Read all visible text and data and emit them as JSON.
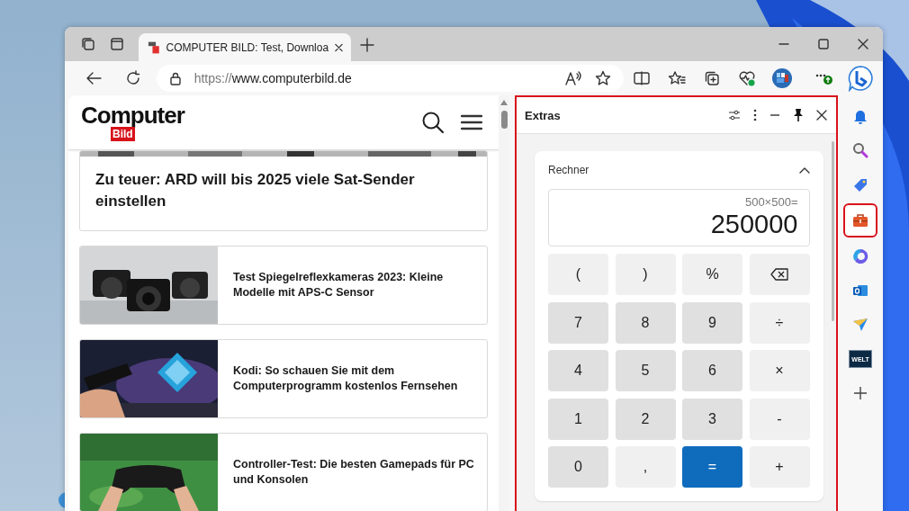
{
  "browser": {
    "tabs": [
      {
        "title": "COMPUTER BILD: Test, Downloa",
        "selected": true
      }
    ],
    "address": {
      "scheme": "https://",
      "host": "www.computerbild.de"
    }
  },
  "web_page": {
    "logo": {
      "word": "Computer",
      "sub": "Bild"
    },
    "articles": [
      {
        "kind": "wide",
        "title": "Zu teuer: ARD will bis 2025 viele Sat-Sender einstellen"
      },
      {
        "kind": "thumb",
        "title": "Test Spiegelreflexkameras 2023: Kleine Modelle mit APS-C Sensor"
      },
      {
        "kind": "thumb",
        "title": "Kodi: So schauen Sie mit dem Computerprogramm kostenlos Fernsehen"
      },
      {
        "kind": "thumb",
        "title": "Controller-Test: Die besten Gamepads für PC und Konsolen"
      }
    ]
  },
  "extras_pane": {
    "title": "Extras",
    "highlighted": true,
    "calculator": {
      "title": "Rechner",
      "expanded": true,
      "expression": "500×500=",
      "result": "250000",
      "keys": [
        {
          "label": "(",
          "kind": "op"
        },
        {
          "label": ")",
          "kind": "op"
        },
        {
          "label": "%",
          "kind": "op"
        },
        {
          "kind": "backspace"
        },
        {
          "label": "7",
          "kind": "digit"
        },
        {
          "label": "8",
          "kind": "digit"
        },
        {
          "label": "9",
          "kind": "digit"
        },
        {
          "label": "÷",
          "kind": "op"
        },
        {
          "label": "4",
          "kind": "digit"
        },
        {
          "label": "5",
          "kind": "digit"
        },
        {
          "label": "6",
          "kind": "digit"
        },
        {
          "label": "×",
          "kind": "op"
        },
        {
          "label": "1",
          "kind": "digit"
        },
        {
          "label": "2",
          "kind": "digit"
        },
        {
          "label": "3",
          "kind": "digit"
        },
        {
          "label": "-",
          "kind": "op"
        },
        {
          "label": "0",
          "kind": "digit"
        },
        {
          "label": ",",
          "kind": "op"
        },
        {
          "label": "=",
          "kind": "equals"
        },
        {
          "label": "+",
          "kind": "op"
        }
      ]
    }
  },
  "sidebar": {
    "items": [
      {
        "kind": "bell",
        "selected": false
      },
      {
        "kind": "search",
        "selected": false
      },
      {
        "kind": "tag",
        "selected": false
      },
      {
        "kind": "toolbox",
        "selected": true
      },
      {
        "kind": "copilot",
        "selected": false
      },
      {
        "kind": "outlook",
        "selected": false
      },
      {
        "kind": "send",
        "selected": false
      },
      {
        "kind": "welt",
        "label": "WELT",
        "selected": false
      },
      {
        "kind": "add",
        "selected": false
      }
    ]
  }
}
